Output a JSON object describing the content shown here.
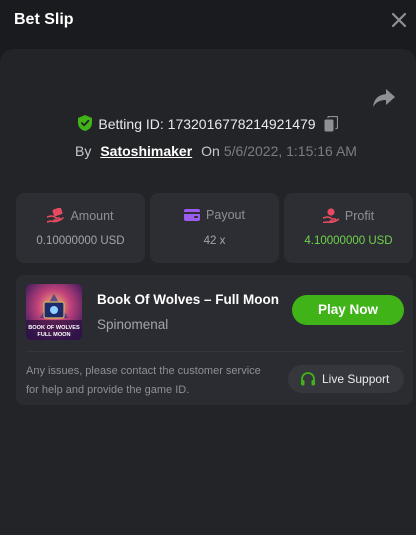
{
  "header": {
    "title": "Bet Slip",
    "close_icon": "close-icon"
  },
  "bet": {
    "id_label": "Betting ID:",
    "id_value": "1732016778214921479",
    "by_label": "By",
    "username": "Satoshimaker",
    "on_label": "On",
    "date": "5/6/2022, 1:15:16 AM"
  },
  "stats": {
    "amount": {
      "label": "Amount",
      "value": "0.10000000 USD",
      "icon": "hand-coin-icon"
    },
    "payout": {
      "label": "Payout",
      "value": "42 x",
      "icon": "wallet-icon"
    },
    "profit": {
      "label": "Profit",
      "value": "4.10000000 USD",
      "icon": "hand-coin-icon"
    }
  },
  "game": {
    "title": "Book Of Wolves – Full Moon",
    "provider": "Spinomenal",
    "play_label": "Play Now",
    "thumb_text_1": "BOOK OF WOLVES",
    "thumb_text_2": "FULL MOON"
  },
  "support": {
    "message": "Any issues, please contact the customer service for help and provide the game ID.",
    "button_label": "Live Support"
  },
  "colors": {
    "accent_green": "#3fb318",
    "profit_green": "#6fd34a",
    "panel": "#232428",
    "card": "#2d2e33"
  }
}
